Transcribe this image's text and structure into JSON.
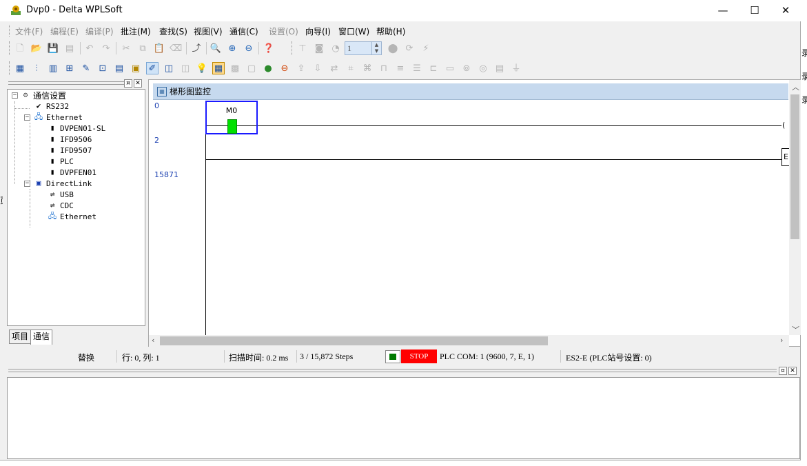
{
  "titlebar": {
    "title": "Dvp0 - Delta WPLSoft",
    "minimize": "—",
    "maximize": "☐",
    "close": "✕"
  },
  "menu": [
    {
      "label": "文件(F)",
      "enabled": false
    },
    {
      "label": "编程(E)",
      "enabled": false
    },
    {
      "label": "编译(P)",
      "enabled": false
    },
    {
      "label": "批注(M)",
      "enabled": true
    },
    {
      "label": "查找(S)",
      "enabled": true
    },
    {
      "label": "视图(V)",
      "enabled": true
    },
    {
      "label": "通信(C)",
      "enabled": true
    },
    {
      "label": "设置(O)",
      "enabled": false
    },
    {
      "label": "向导(I)",
      "enabled": true
    },
    {
      "label": "窗口(W)",
      "enabled": true
    },
    {
      "label": "帮助(H)",
      "enabled": true
    }
  ],
  "toolbar": {
    "spin_value": "1",
    "spin_up": "▲",
    "spin_down": "▼"
  },
  "leftpane": {
    "pin": "¤",
    "close": "✕",
    "tree": {
      "root": "通信设置",
      "rs232": "RS232",
      "ethernet": "Ethernet",
      "ethernet_children": [
        "DVPEN01-SL",
        "IFD9506",
        "IFD9507",
        "PLC",
        "DVPFEN01"
      ],
      "directlink": "DirectLink",
      "directlink_children": [
        "USB",
        "CDC",
        "Ethernet"
      ]
    },
    "tabs": [
      "项目",
      "通信"
    ]
  },
  "ladder": {
    "title": "梯形图监控",
    "rungs": [
      "0",
      "2",
      "15871"
    ],
    "contact_label": "M0",
    "coil_edge": "(",
    "end_edge": "E"
  },
  "status": {
    "mode": "替换",
    "position": "行: 0, 列: 1",
    "scan_time": "扫描时间: 0.2 ms",
    "steps": "3 / 15,872 Steps",
    "run_state": "STOP",
    "com": "PLC COM: 1 (9600, 7, E, 1)",
    "station": "ES2-E (PLC站号设置: 0)"
  },
  "bottompane": {
    "pin": "¤",
    "close": "✕"
  },
  "colors": {
    "title_bar_bg": "#c6d9ee",
    "contact_on": "#00e000",
    "stop_red": "#ff0000",
    "selection_blue": "#1a1aff"
  },
  "icons": {
    "app": "delta-wplsoft-icon"
  },
  "background": {
    "right_edge_chars": [
      "录",
      "录",
      "录"
    ],
    "left_edge_char": "页"
  }
}
